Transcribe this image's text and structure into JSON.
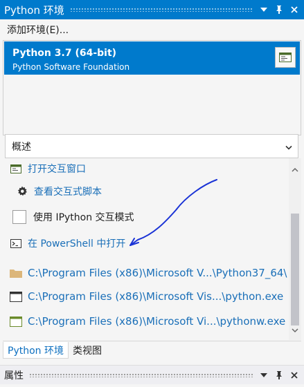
{
  "panel_title": "Python 环境",
  "toolbar": {
    "add_environment": "添加环境(E)..."
  },
  "environments": [
    {
      "name": "Python 3.7 (64-bit)",
      "publisher": "Python Software Foundation",
      "selected": true
    }
  ],
  "view_select": {
    "value": "概述"
  },
  "actions": {
    "open_interactive": "打开交互窗口",
    "view_scripts": "查看交互式脚本",
    "use_ipython": "使用 IPython 交互模式",
    "open_powershell": "在 PowerShell 中打开"
  },
  "paths": [
    "C:\\Program Files (x86)\\Microsoft V...\\Python37_64\\",
    "C:\\Program Files (x86)\\Microsoft Vis...\\python.exe",
    "C:\\Program Files (x86)\\Microsoft Vi...\\pythonw.exe"
  ],
  "tabs": [
    {
      "label": "Python 环境",
      "active": true
    },
    {
      "label": "类视图",
      "active": false
    }
  ],
  "bottom_panel": {
    "title": "属性"
  },
  "colors": {
    "accent": "#007acc",
    "link": "#1a6fb8",
    "annotation": "#1a33d6"
  },
  "icons": [
    "pin-icon",
    "close-icon",
    "chevron-down-icon",
    "window-icon",
    "gear-icon",
    "terminal-icon",
    "folder-icon",
    "app-icon"
  ]
}
